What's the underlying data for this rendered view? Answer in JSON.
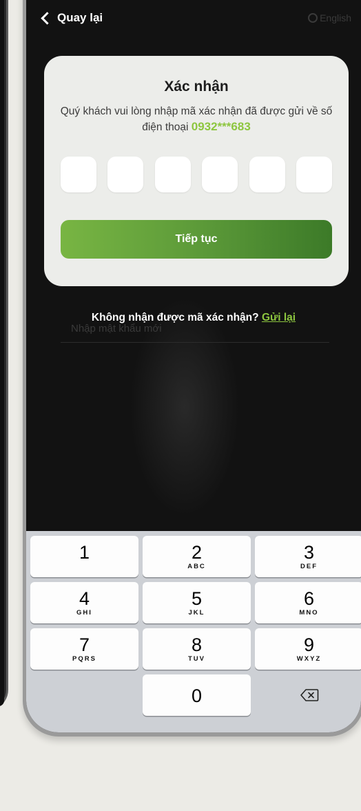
{
  "header": {
    "back_label": "Quay lại",
    "language_label": "English"
  },
  "card": {
    "title": "Xác nhận",
    "description": "Quý khách vui lòng nhập mã xác nhận đã được gửi về số điện thoại",
    "phone_masked": "0932***683",
    "otp_boxes": [
      "",
      "",
      "",
      "",
      "",
      ""
    ],
    "continue_label": "Tiếp tục"
  },
  "resend": {
    "prompt": "Không nhận được mã xác nhận?",
    "link_label": "Gửi lại"
  },
  "ghost_placeholder": "Nhập mật khẩu mới",
  "keypad": {
    "keys": [
      {
        "num": "1",
        "letters": ""
      },
      {
        "num": "2",
        "letters": "ABC"
      },
      {
        "num": "3",
        "letters": "DEF"
      },
      {
        "num": "4",
        "letters": "GHI"
      },
      {
        "num": "5",
        "letters": "JKL"
      },
      {
        "num": "6",
        "letters": "MNO"
      },
      {
        "num": "7",
        "letters": "PQRS"
      },
      {
        "num": "8",
        "letters": "TUV"
      },
      {
        "num": "9",
        "letters": "WXYZ"
      }
    ],
    "zero": "0"
  },
  "colors": {
    "accent_green": "#8dc63f",
    "button_gradient_start": "#78b543",
    "button_gradient_end": "#3c7a28",
    "screen_bg": "#121212"
  }
}
